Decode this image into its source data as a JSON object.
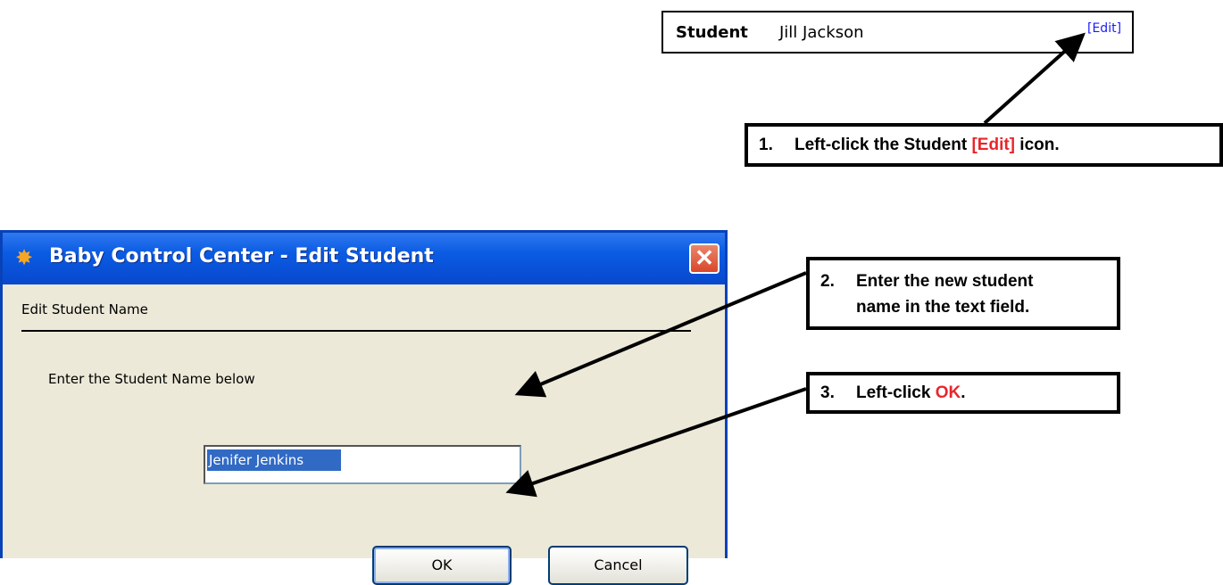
{
  "student_strip": {
    "label": "Student",
    "name": "Jill Jackson",
    "edit_link": "[Edit]"
  },
  "callouts": {
    "step1": {
      "number": "1.",
      "text_before": "Left-click the Student ",
      "highlight": "[Edit]",
      "text_after": " icon."
    },
    "step2": {
      "number": "2.",
      "line1": "Enter the new student",
      "line2": "name in the text field."
    },
    "step3": {
      "number": "3.",
      "text_before": "Left-click ",
      "highlight": "OK",
      "text_after": "."
    },
    "highlight_color": "#e8262b"
  },
  "dialog": {
    "title": "Baby Control Center - Edit Student",
    "app_icon": "app-icon",
    "close_label": "✕",
    "section_label": "Edit Student Name",
    "instruction": "Enter the Student Name below",
    "input_value": "Jenifer Jenkins",
    "ok_label": "OK",
    "cancel_label": "Cancel"
  },
  "colors": {
    "titlebar": "#0a5be3",
    "client_bg": "#ece9d8",
    "selection": "#316ac5",
    "link": "#1a1aff"
  }
}
